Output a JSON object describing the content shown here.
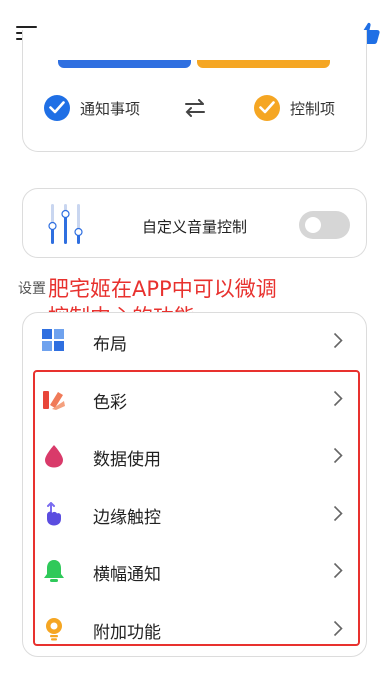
{
  "tabs": {
    "notify_label": "通知事项",
    "control_label": "控制项",
    "accent_blue": "#2f6fe0",
    "accent_orange": "#f5a623"
  },
  "volume": {
    "label": "自定义音量控制",
    "toggle_on": false
  },
  "settings": {
    "section_label": "设置",
    "overlay_annotation": "肥宅姬在APP中可以微调\n控制中心的功能",
    "items": [
      {
        "label": "布局",
        "icon": "layout-icon"
      },
      {
        "label": "色彩",
        "icon": "palette-icon"
      },
      {
        "label": "数据使用",
        "icon": "drop-icon"
      },
      {
        "label": "边缘触控",
        "icon": "touch-icon"
      },
      {
        "label": "横幅通知",
        "icon": "bell-icon"
      },
      {
        "label": "附加功能",
        "icon": "bulb-icon"
      }
    ]
  }
}
